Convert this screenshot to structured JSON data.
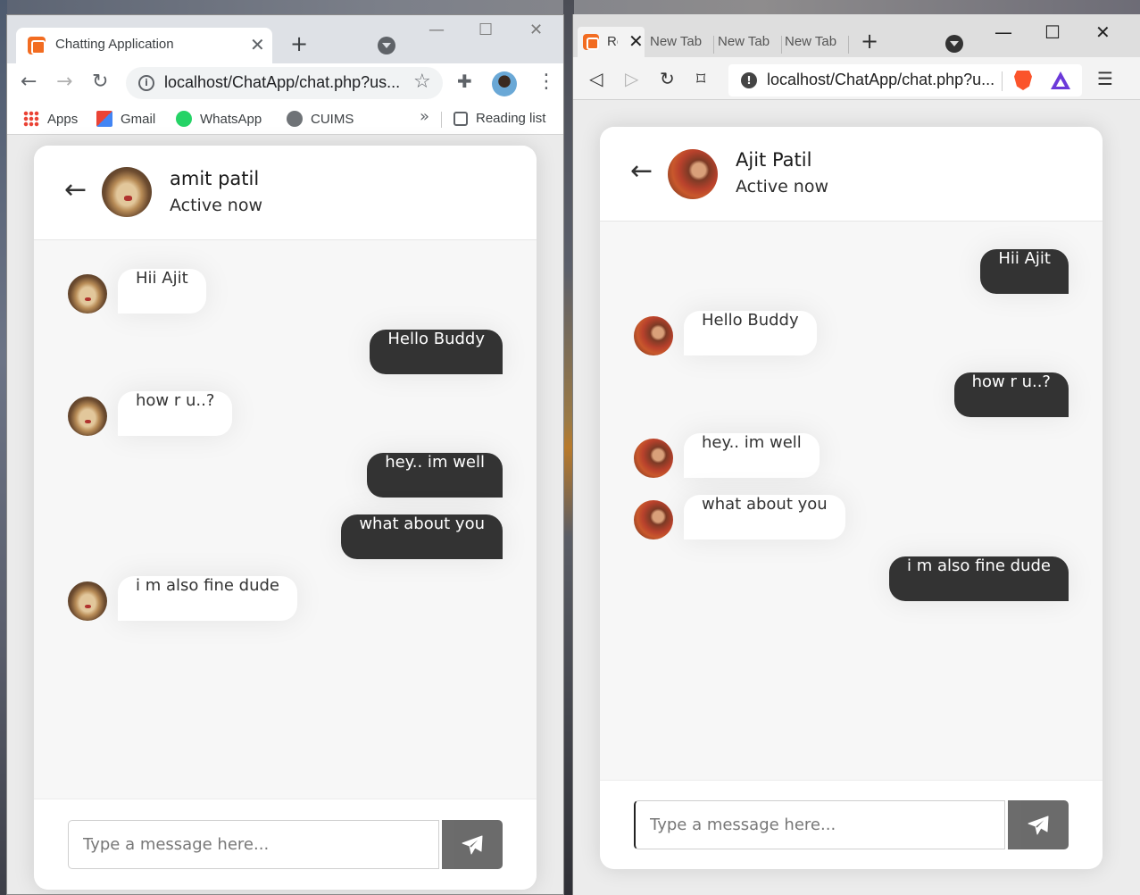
{
  "left_browser": {
    "tab_title": "Chatting Application",
    "url": "localhost/ChatApp/chat.php?us...",
    "bookmarks": [
      "Apps",
      "Gmail",
      "WhatsApp",
      "CUIMS"
    ],
    "reading_list": "Reading list"
  },
  "right_browser": {
    "tabs": [
      "New Tab",
      "New Tab",
      "New Tab"
    ],
    "active_tab_title": "Re",
    "url": "localhost/ChatApp/chat.php?u..."
  },
  "left_chat": {
    "user_name": "amit patil",
    "status": "Active now",
    "placeholder": "Type a message here...",
    "messages": [
      {
        "dir": "in",
        "text": "Hii Ajit"
      },
      {
        "dir": "out",
        "text": "Hello Buddy"
      },
      {
        "dir": "in",
        "text": "how r u..?"
      },
      {
        "dir": "out",
        "text": "hey.. im well"
      },
      {
        "dir": "out",
        "text": "what about you"
      },
      {
        "dir": "in",
        "text": "i m also fine dude"
      }
    ]
  },
  "right_chat": {
    "user_name": "Ajit Patil",
    "status": "Active now",
    "placeholder": "Type a message here...",
    "messages": [
      {
        "dir": "out",
        "text": "Hii Ajit"
      },
      {
        "dir": "in",
        "text": "Hello Buddy"
      },
      {
        "dir": "out",
        "text": "how r u..?"
      },
      {
        "dir": "in",
        "text": "hey.. im well"
      },
      {
        "dir": "in",
        "text": "what about you"
      },
      {
        "dir": "out",
        "text": "i m also fine dude"
      }
    ]
  },
  "colors": {
    "outgoing_bubble": "#333333",
    "incoming_bubble": "#ffffff",
    "xampp_orange": "#f26c21"
  }
}
